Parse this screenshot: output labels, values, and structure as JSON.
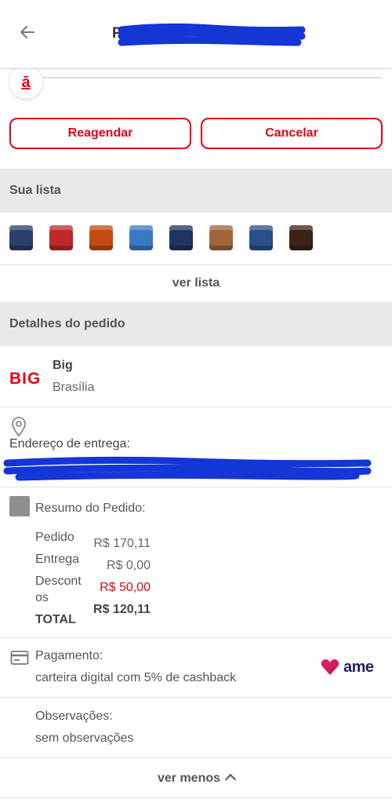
{
  "header": {
    "title": "Pe",
    "back_icon": "arrow-left-icon"
  },
  "timeline": {
    "step_logo": "ā"
  },
  "actions": {
    "reschedule_label": "Reagendar",
    "cancel_label": "Cancelar"
  },
  "list_section": {
    "title": "Sua lista",
    "products": [
      {
        "name": "product-1",
        "color": "#2b3f6b"
      },
      {
        "name": "product-2",
        "color": "#c0282a"
      },
      {
        "name": "product-3",
        "color": "#c44a12"
      },
      {
        "name": "product-4",
        "color": "#3b78c4"
      },
      {
        "name": "product-5",
        "color": "#1f3561"
      },
      {
        "name": "product-6",
        "color": "#a0653a"
      },
      {
        "name": "product-7",
        "color": "#2a4f8a"
      },
      {
        "name": "product-8",
        "color": "#3a2214"
      }
    ],
    "see_list_label": "ver lista"
  },
  "details_section": {
    "title": "Detalhes do pedido",
    "store": {
      "logo_text": "BIG",
      "name": "Big",
      "city": "Brasília"
    },
    "address_label": "Endereço de entrega:",
    "summary": {
      "title": "Resumo do Pedido:",
      "rows": [
        {
          "label": "Pedido",
          "value": "R$ 170,11"
        },
        {
          "label": "Entrega",
          "value": "R$ 0,00"
        },
        {
          "label": "Descont os",
          "value": "R$ 50,00"
        },
        {
          "label": "TOTAL",
          "value": "R$ 120,11"
        }
      ]
    },
    "payment": {
      "title": "Pagamento:",
      "description": "carteira digital com 5% de cashback",
      "brand": "ame"
    },
    "observations": {
      "title": "Observações:",
      "value": "sem observações"
    },
    "see_less_label": "ver menos"
  },
  "colors": {
    "accent": "#e60014",
    "section_bg": "#e9e9eb",
    "discount": "#d01010",
    "redaction": "#1436d6"
  }
}
